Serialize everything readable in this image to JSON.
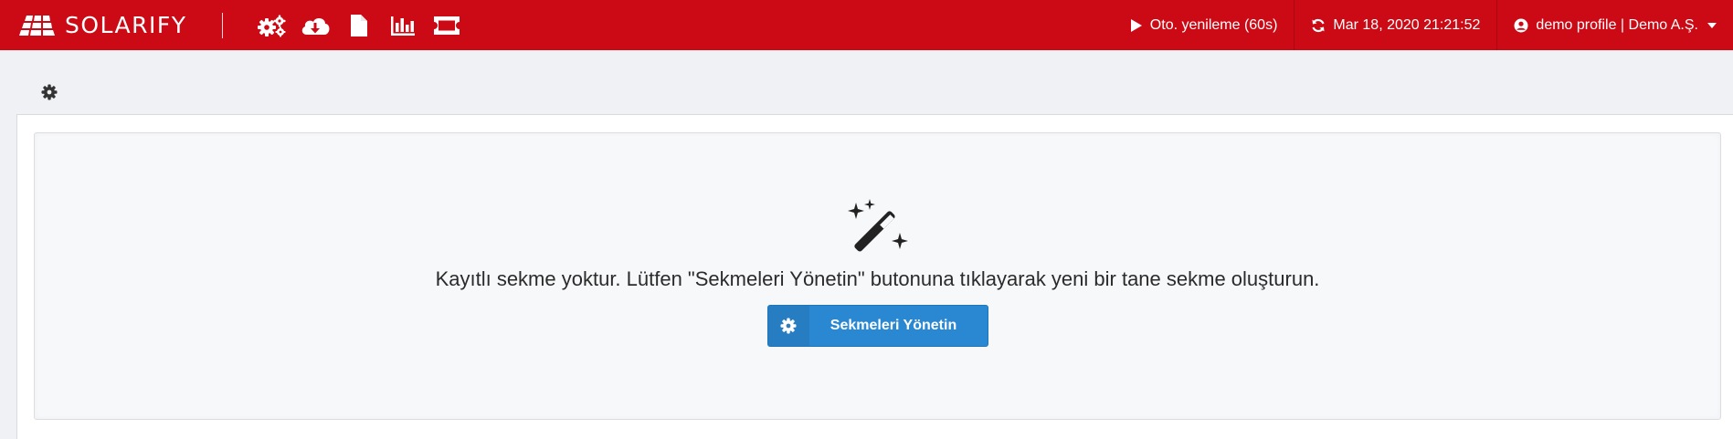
{
  "header": {
    "brand": "SOLARIFY",
    "brand_color": "#cc0a15",
    "tools": [
      {
        "icon": "cogs-icon"
      },
      {
        "icon": "cloud-download-icon"
      },
      {
        "icon": "file-icon"
      },
      {
        "icon": "bar-chart-icon"
      },
      {
        "icon": "ticket-icon"
      }
    ],
    "auto_refresh_label": "Oto. yenileme (60s)",
    "last_refresh": "Mar 18, 2020 21:21:52",
    "profile_label": "demo profile | Demo A.Ş."
  },
  "main": {
    "empty_message": "Kayıtlı sekme yoktur. Lütfen \"Sekmeleri Yönetin\" butonuna tıklayarak yeni bir tane sekme oluşturun.",
    "manage_button_label": "Sekmeleri Yönetin",
    "button_color": "#2a88d2"
  }
}
